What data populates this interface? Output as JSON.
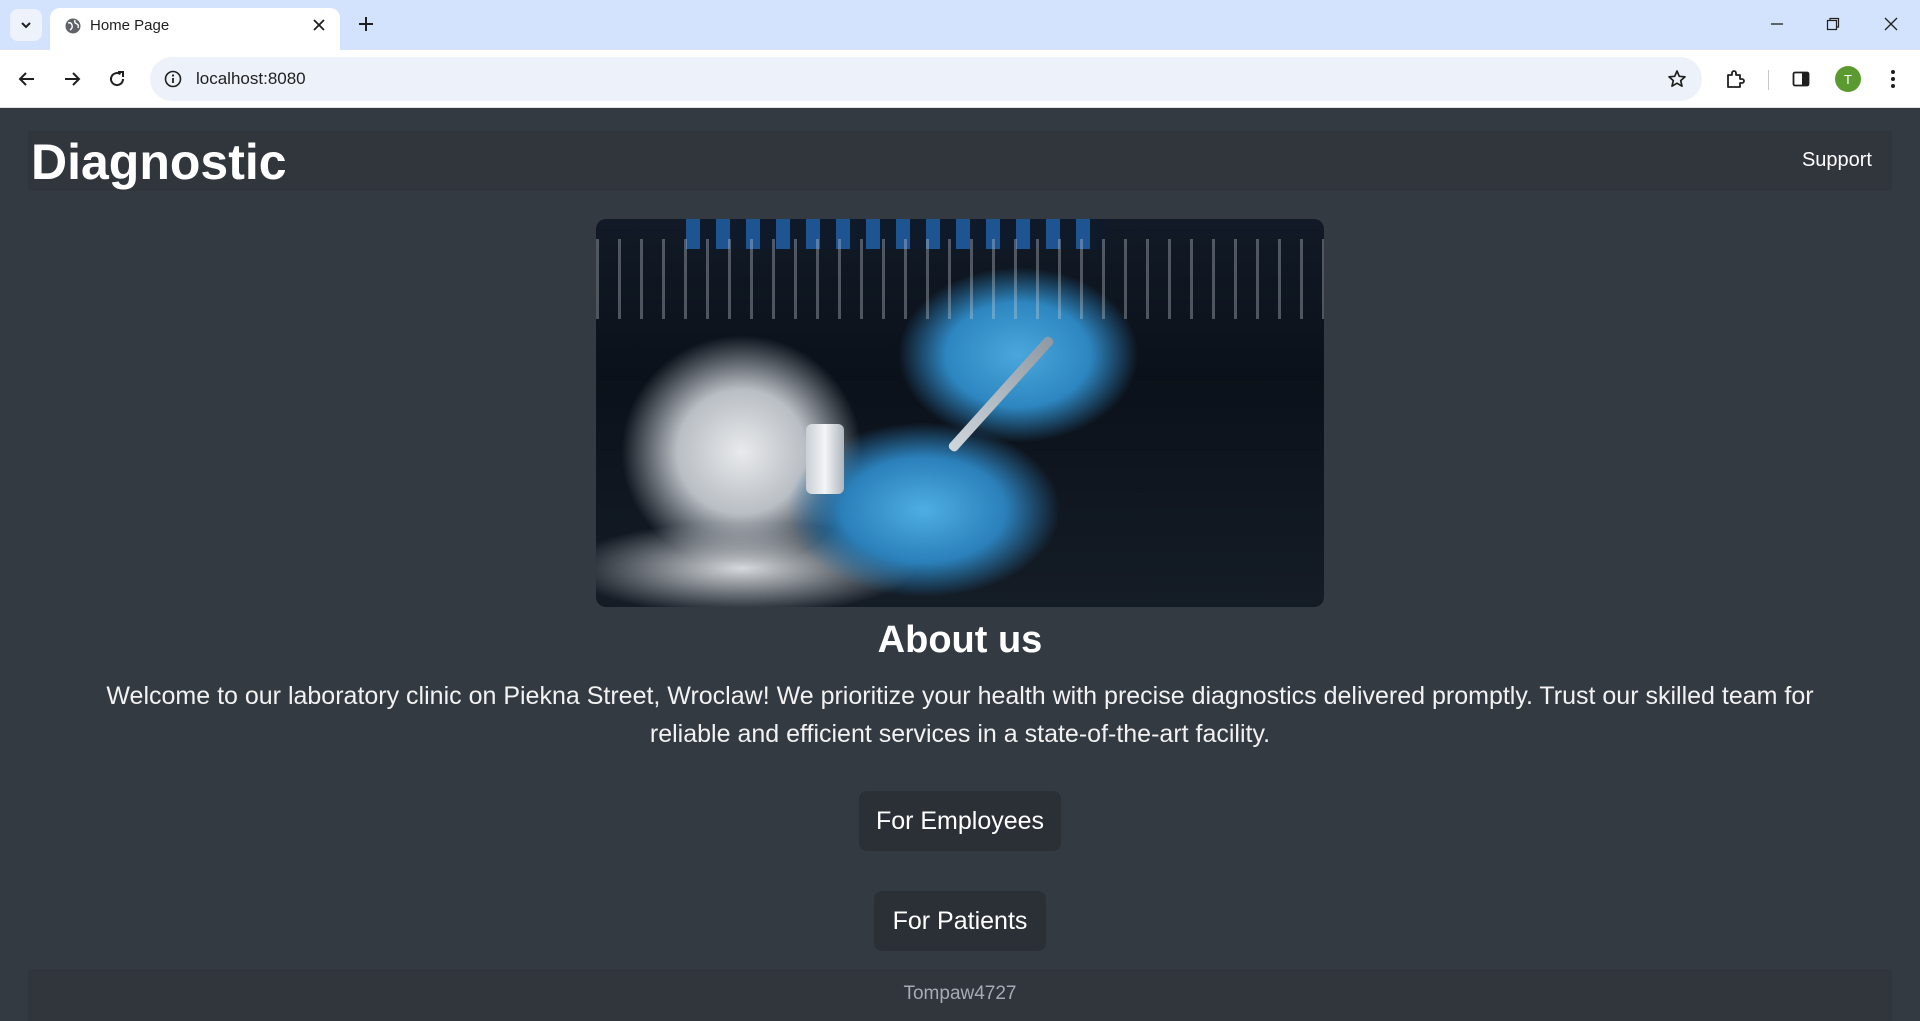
{
  "browser": {
    "tab_title": "Home Page",
    "url": "localhost:8080",
    "profile_initial": "T",
    "icons": {
      "tab_search": "chevron-down-icon",
      "favicon": "globe-icon",
      "tab_close": "close-icon",
      "new_tab": "plus-icon",
      "back": "arrow-left-icon",
      "forward": "arrow-right-icon",
      "reload": "reload-icon",
      "site_info": "info-icon",
      "bookmark": "star-icon",
      "extensions": "puzzle-icon",
      "side_panel": "side-panel-icon",
      "menu": "kebab-menu-icon",
      "minimize": "minimize-icon",
      "restore": "restore-icon",
      "close_window": "close-icon"
    }
  },
  "header": {
    "brand": "Diagnostic",
    "support_label": "Support"
  },
  "about": {
    "title": "About us",
    "text": "Welcome to our laboratory clinic on Piekna Street, Wroclaw! We prioritize your health with precise diagnostics delivered promptly. Trust our skilled team for reliable and efficient services in a state-of-the-art facility."
  },
  "actions": {
    "employees_label": "For Employees",
    "patients_label": "For Patients"
  },
  "footer": {
    "text": "Tompaw4727"
  },
  "colors": {
    "page_bg": "#343a42",
    "navbar_bg": "#31363d",
    "button_bg": "#2b3036",
    "tabbar_bg": "#d3e3fd",
    "profile_bg": "#5a9a2e"
  }
}
